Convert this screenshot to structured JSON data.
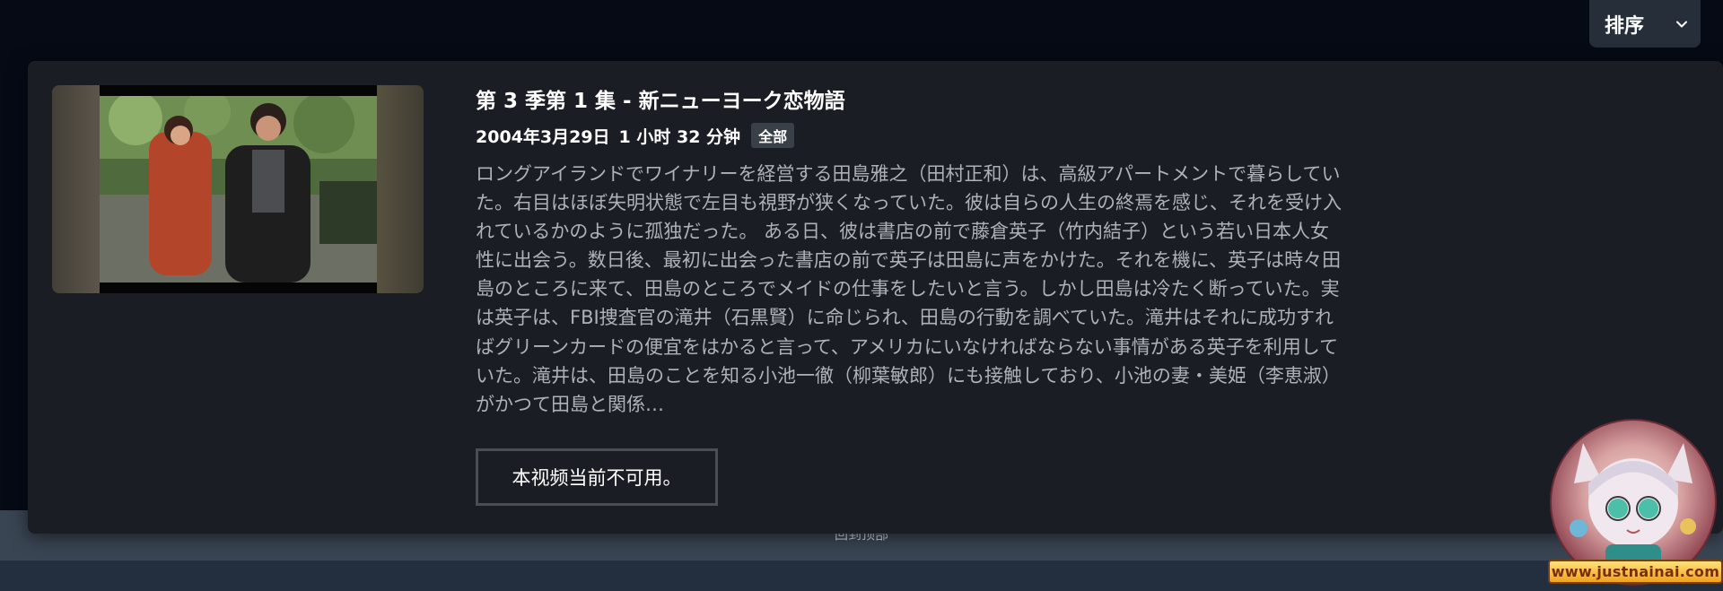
{
  "sort": {
    "label": "排序",
    "icon": "chevron-down-icon"
  },
  "episode": {
    "title": "第 3 季第 1 集 - 新ニューヨーク恋物語",
    "date": "2004年3月29日",
    "duration": "1 小时 32 分钟",
    "rating": "全部",
    "synopsis": "ロングアイランドでワイナリーを経営する田島雅之（田村正和）は、高級アパートメントで暮らしていた。右目はほぼ失明状態で左目も視野が狭くなっていた。彼は自らの人生の終焉を感じ、それを受け入れているかのように孤独だった。 ある日、彼は書店の前で藤倉英子（竹内結子）という若い日本人女性に出会う。数日後、最初に出会った書店の前で英子は田島に声をかけた。それを機に、英子は時々田島のところに来て、田島のところでメイドの仕事をしたいと言う。しかし田島は冷たく断っていた。実は英子は、FBI捜査官の滝井（石黒賢）に命じられ、田島の行動を調べていた。滝井はそれに成功すればグリーンカードの便宜をはかると言って、アメリカにいなければならない事情がある英子を利用していた。滝井は、田島のことを知る小池一徹（柳葉敏郎）にも接触しており、小池の妻・美姫（李恵淑）がかつて田島と関係…",
    "unavailable_label": "本视频当前不可用。"
  },
  "footer": {
    "back_to_top": "回到顶部"
  },
  "watermark": {
    "text": "www.justnainai.com"
  },
  "colors": {
    "page_bg": "#050a15",
    "card_bg": "#1a1e24",
    "synopsis_text": "#aeb2b8",
    "footer_band": "#3a4553"
  }
}
